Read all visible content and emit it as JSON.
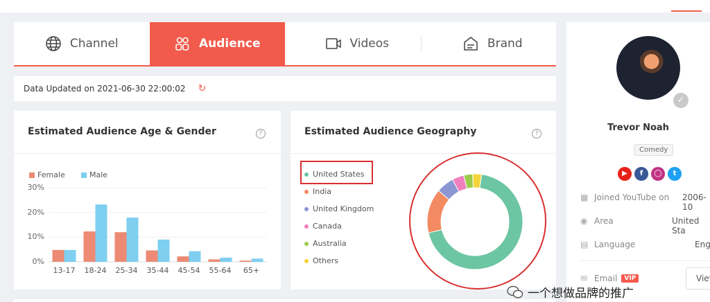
{
  "tabs": [
    {
      "label": "Channel",
      "icon": "globe-icon",
      "active": false
    },
    {
      "label": "Audience",
      "icon": "users-icon",
      "active": true
    },
    {
      "label": "Videos",
      "icon": "video-camera-icon",
      "active": false
    },
    {
      "label": "Brand",
      "icon": "brand-box-icon",
      "active": false
    }
  ],
  "updated": {
    "text": "Data Updated on 2021-06-30 22:00:02"
  },
  "age_panel": {
    "title": "Estimated Audience Age & Gender",
    "legend": [
      "Female",
      "Male"
    ],
    "y_ticks": [
      "30%",
      "20%",
      "10%",
      "0%"
    ]
  },
  "geo_panel": {
    "title": "Estimated Audience Geography",
    "countries": [
      "United States",
      "India",
      "United Kingdom",
      "Canada",
      "Australia",
      "Others"
    ]
  },
  "colors": {
    "accent": "#f25a4b",
    "female": "#ec8a74",
    "male": "#7ecff0",
    "geo": [
      "#6cc5a3",
      "#f38a62",
      "#8a97d2",
      "#ef7fbf",
      "#9ccc4a",
      "#f4d43a"
    ]
  },
  "chart_data": [
    {
      "type": "bar",
      "title": "Estimated Audience Age & Gender",
      "categories": [
        "13-17",
        "18-24",
        "25-34",
        "35-44",
        "45-54",
        "55-64",
        "65+"
      ],
      "series": [
        {
          "name": "Female",
          "values": [
            4.8,
            12.3,
            12.0,
            4.6,
            2.2,
            1.0,
            0.5
          ]
        },
        {
          "name": "Male",
          "values": [
            4.8,
            23.2,
            17.9,
            9.0,
            4.3,
            1.7,
            1.3
          ]
        }
      ],
      "ylim": [
        0,
        30
      ],
      "grid": true,
      "legend": "top-left"
    },
    {
      "type": "pie",
      "title": "Estimated Audience Geography",
      "categories": [
        "United States",
        "India",
        "United Kingdom",
        "Canada",
        "Australia",
        "Others"
      ],
      "values": [
        69,
        15,
        6,
        4,
        3,
        3
      ],
      "legend": "left"
    }
  ],
  "profile": {
    "name": "Trevor Noah",
    "category": "Comedy",
    "socials": [
      "youtube-icon",
      "facebook-icon",
      "instagram-icon",
      "twitter-icon"
    ],
    "joined_label": "Joined YouTube on",
    "joined_value": "2006-10",
    "area_label": "Area",
    "area_value": "United Sta",
    "language_label": "Language",
    "language_value": "Eng",
    "email_label": "Email",
    "vip_label": "VIP",
    "view_label": "View"
  },
  "watermark": {
    "text": "一个想做品牌的推广"
  }
}
